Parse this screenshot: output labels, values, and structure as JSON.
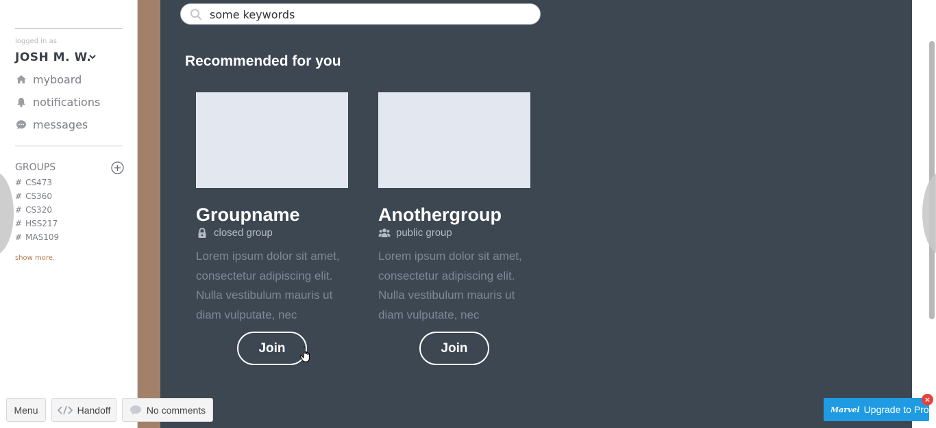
{
  "sidebar": {
    "logged_in_label": "logged in as",
    "user_name": "JOSH M. W.",
    "nav": [
      {
        "label": "myboard",
        "icon": "home-icon"
      },
      {
        "label": "notifications",
        "icon": "bell-icon"
      },
      {
        "label": "messages",
        "icon": "chat-bubble-icon"
      }
    ],
    "groups_title": "GROUPS",
    "groups": [
      "CS473",
      "CS360",
      "CS320",
      "HSS217",
      "MAS109"
    ],
    "show_more": "show more."
  },
  "search": {
    "value": "some keywords",
    "icon": "search-icon"
  },
  "main": {
    "section_title": "Recommended for you",
    "cards": [
      {
        "name": "Groupname",
        "type": "closed group",
        "type_icon": "lock-icon",
        "description": "Lorem ipsum dolor sit amet, consectetur adipiscing elit. Nulla vestibulum mauris ut diam vulputate, nec",
        "join_label": "Join"
      },
      {
        "name": "Anothergroup",
        "type": "public group",
        "type_icon": "users-icon",
        "description": "Lorem ipsum dolor sit amet, consectetur adipiscing elit. Nulla vestibulum mauris ut diam vulputate, nec",
        "join_label": "Join"
      }
    ]
  },
  "toolbar": {
    "menu_label": "Menu",
    "handoff_label": "Handoff",
    "comments_label": "No comments"
  },
  "upgrade": {
    "brand": "Marvel",
    "label": "Upgrade to Pro",
    "close": "×"
  },
  "colors": {
    "main_bg": "#3d4752",
    "backdrop": "#a3806a",
    "upgrade_blue": "#1e9be3",
    "close_red": "#e8413b"
  }
}
